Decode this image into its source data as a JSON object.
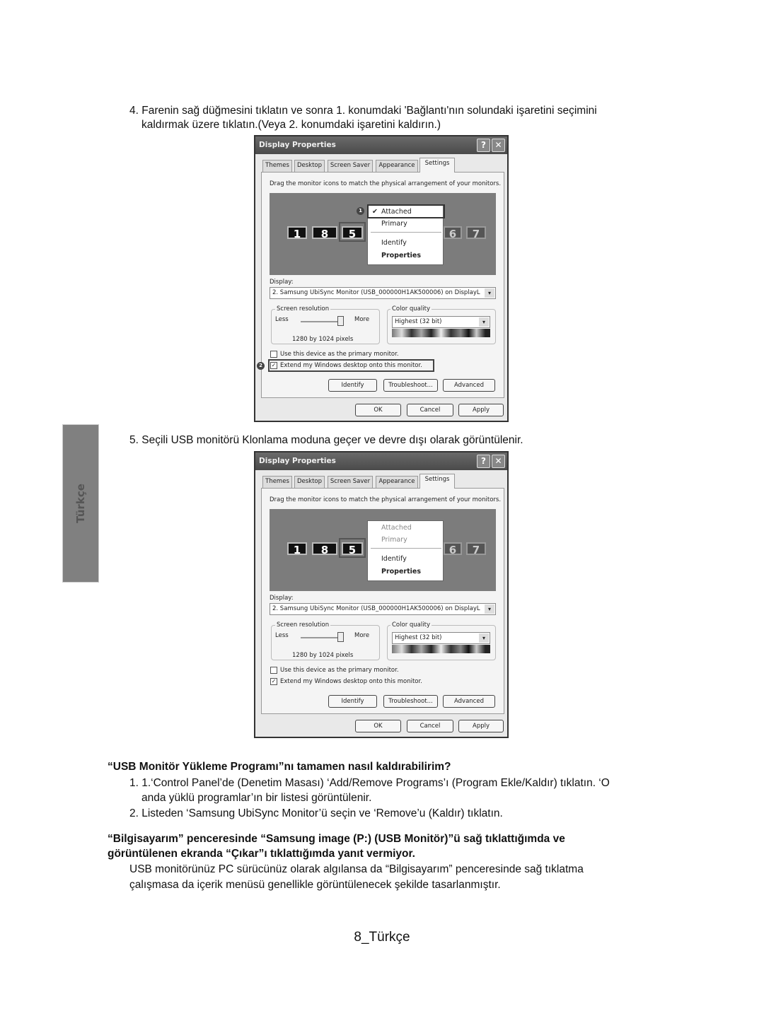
{
  "side_tab": {
    "label": "Türkçe"
  },
  "step4": {
    "text": "4. Farenin sağ düğmesini tıklatın ve sonra 1. konumdaki 'Bağlantı'nın solundaki işaretini seçimini",
    "text2": "kaldırmak üzere tıklatın.(Veya 2. konumdaki işaretini kaldırın.)"
  },
  "step5": {
    "text": "5. Seçili USB monitörü Klonlama moduna geçer ve devre dışı olarak görüntülenir."
  },
  "dialog": {
    "title": "Display Properties",
    "help": "?",
    "close": "✕",
    "tabs": [
      "Themes",
      "Desktop",
      "Screen Saver",
      "Appearance",
      "Settings"
    ],
    "instruction": "Drag the monitor icons to match the physical arrangement of your monitors.",
    "monitors": [
      "1",
      "8",
      "5",
      "6",
      "7"
    ],
    "menu": {
      "attached": "Attached",
      "primary": "Primary",
      "identify": "Identify",
      "properties": "Properties",
      "check": "✔"
    },
    "display_label": "Display:",
    "display_value": "2. Samsung UbiSync Monitor (USB_000000H1AK500006) on DisplayL",
    "resolution_label": "Screen resolution",
    "less": "Less",
    "more": "More",
    "resolution_value": "1280 by 1024 pixels",
    "color_label": "Color quality",
    "color_value": "Highest (32 bit)",
    "primary_cb": "Use this device as the primary monitor.",
    "extend_cb": "Extend my Windows desktop onto this monitor.",
    "btn_identify": "Identify",
    "btn_troubleshoot": "Troubleshoot...",
    "btn_advanced": "Advanced",
    "btn_ok": "OK",
    "btn_cancel": "Cancel",
    "btn_apply": "Apply",
    "badge1": "1",
    "badge2": "2"
  },
  "faq1": {
    "question": "“USB Monitör Yükleme Programı”nı tamamen nasıl kaldırabilirim?",
    "item1a": "1. 1.‘Control Panel’de (Denetim Masası) ‘Add/Remove Programs’ı (Program Ekle/Kaldır) tıklatın. ‘O",
    "item1b": "anda yüklü programlar’ın bir listesi görüntülenir.",
    "item2": "2. Listeden ‘Samsung UbiSync Monitor’ü seçin ve ‘Remove’u (Kaldır) tıklatın."
  },
  "faq2": {
    "question1": "“Bilgisayarım” penceresinde “Samsung image (P:) (USB Monitör)”ü sağ tıklattığımda ve",
    "question2": "görüntülenen ekranda “Çıkar”ı tıklattığımda yanıt vermiyor.",
    "answer1": "USB monitörünüz PC sürücünüz olarak algılansa da “Bilgisayarım” penceresinde sağ tıklatma",
    "answer2": "çalışmasa da içerik menüsü genellikle görüntülenecek şekilde tasarlanmıştır."
  },
  "footer": {
    "page": "8_Türkçe"
  }
}
